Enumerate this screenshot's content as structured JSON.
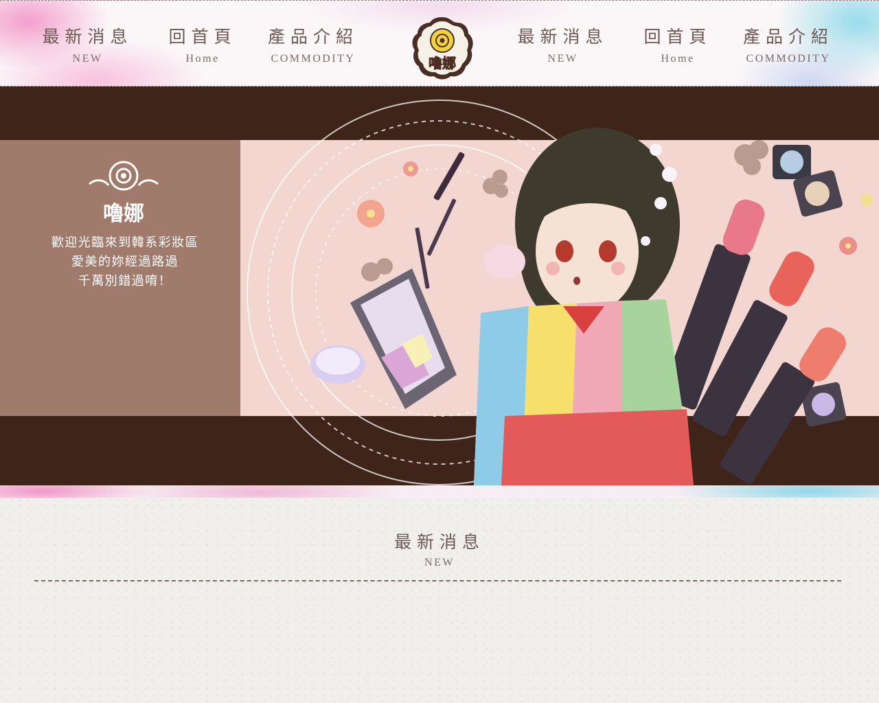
{
  "nav": {
    "left": [
      {
        "zh": "最新消息",
        "en": "NEW"
      },
      {
        "zh": "回首頁",
        "en": "Home"
      },
      {
        "zh": "產品介紹",
        "en": "COMMODITY"
      }
    ],
    "right": [
      {
        "zh": "最新消息",
        "en": "NEW"
      },
      {
        "zh": "回首頁",
        "en": "Home"
      },
      {
        "zh": "產品介紹",
        "en": "COMMODITY"
      }
    ],
    "logo_text": "嚕娜"
  },
  "banner": {
    "logo_text": "嚕娜",
    "lines": [
      "歡迎光臨來到韓系彩妝區",
      "愛美的妳經過路過",
      "千萬別錯過唷！"
    ]
  },
  "section": {
    "zh": "最新消息",
    "en": "NEW"
  },
  "colors": {
    "text_brown": "#6d5a55",
    "banner_dark": "#3e2419",
    "banner_band": "#a07a6a",
    "logo_yellow": "#f2d43a"
  }
}
